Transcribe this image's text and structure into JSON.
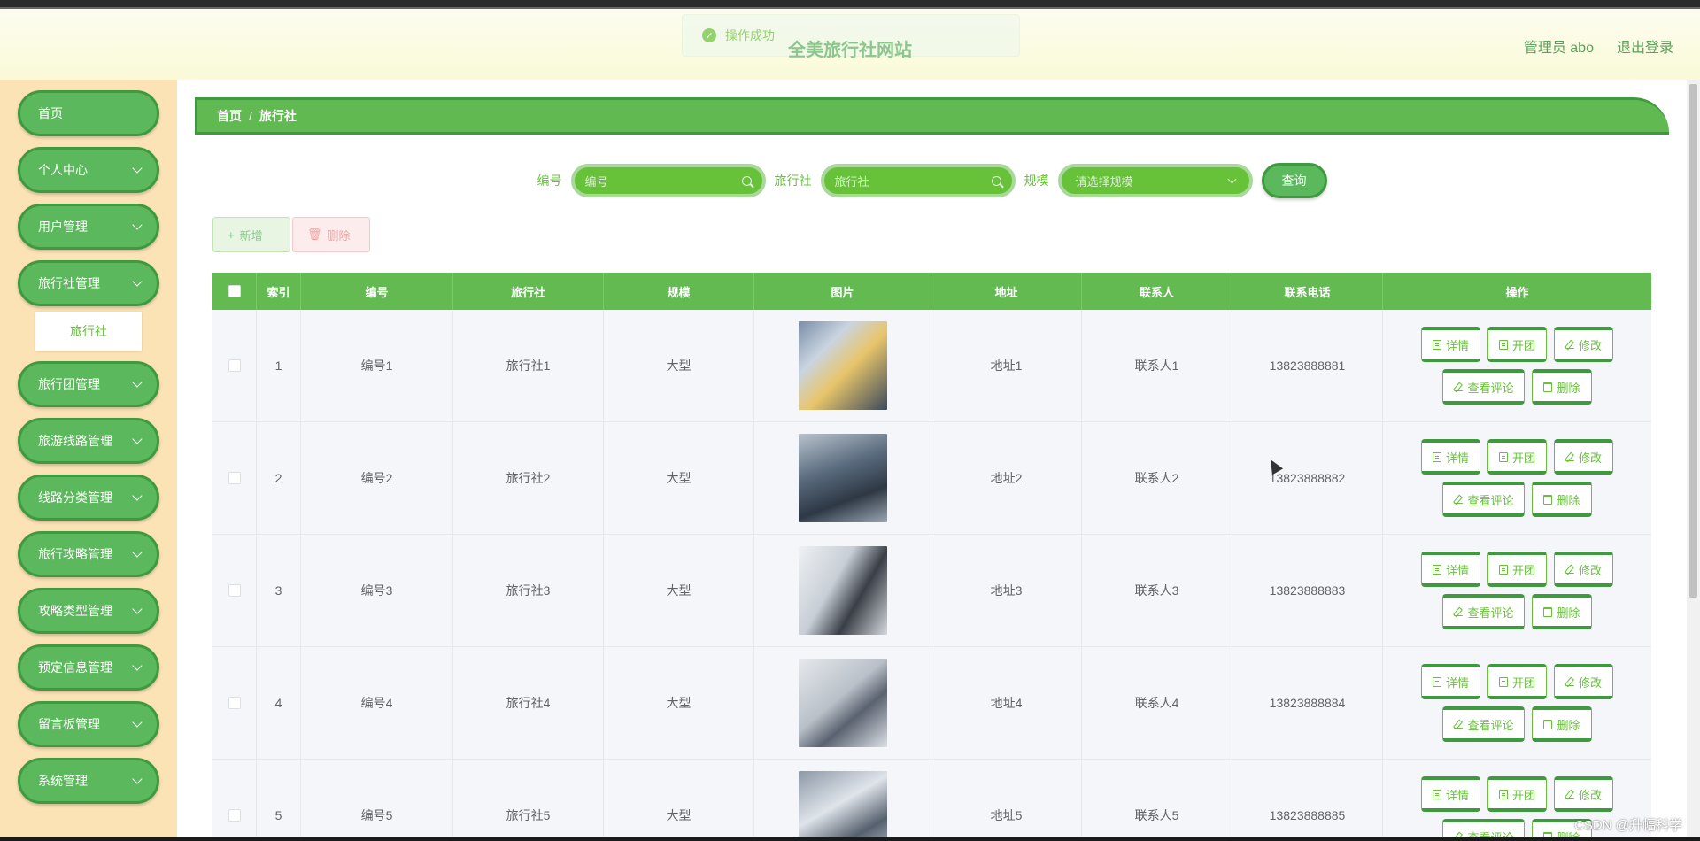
{
  "header": {
    "site_title": "全美旅行社网站",
    "user_label": "管理员 abo",
    "logout_label": "退出登录",
    "toast": "操作成功"
  },
  "sidebar": {
    "items": [
      {
        "label": "首页",
        "has_children": false
      },
      {
        "label": "个人中心",
        "has_children": true
      },
      {
        "label": "用户管理",
        "has_children": true
      },
      {
        "label": "旅行社管理",
        "has_children": true
      },
      {
        "label": "旅行团管理",
        "has_children": true
      },
      {
        "label": "旅游线路管理",
        "has_children": true
      },
      {
        "label": "线路分类管理",
        "has_children": true
      },
      {
        "label": "旅行攻略管理",
        "has_children": true
      },
      {
        "label": "攻略类型管理",
        "has_children": true
      },
      {
        "label": "预定信息管理",
        "has_children": true
      },
      {
        "label": "留言板管理",
        "has_children": true
      },
      {
        "label": "系统管理",
        "has_children": true
      }
    ],
    "sub_item": "旅行社"
  },
  "breadcrumb": {
    "home": "首页",
    "sep": "/",
    "current": "旅行社"
  },
  "search": {
    "field1_label": "编号",
    "field1_placeholder": "编号",
    "field2_label": "旅行社",
    "field2_placeholder": "旅行社",
    "field3_label": "规模",
    "field3_placeholder": "请选择规模",
    "query_button": "查询"
  },
  "actions": {
    "add": "新增",
    "delete": "删除"
  },
  "table": {
    "headers": [
      "索引",
      "编号",
      "旅行社",
      "规模",
      "图片",
      "地址",
      "联系人",
      "联系电话",
      "操作"
    ],
    "rows": [
      {
        "index": "1",
        "code": "编号1",
        "agency": "旅行社1",
        "size": "大型",
        "address": "地址1",
        "contact": "联系人1",
        "phone": "13823888881"
      },
      {
        "index": "2",
        "code": "编号2",
        "agency": "旅行社2",
        "size": "大型",
        "address": "地址2",
        "contact": "联系人2",
        "phone": "13823888882"
      },
      {
        "index": "3",
        "code": "编号3",
        "agency": "旅行社3",
        "size": "大型",
        "address": "地址3",
        "contact": "联系人3",
        "phone": "13823888883"
      },
      {
        "index": "4",
        "code": "编号4",
        "agency": "旅行社4",
        "size": "大型",
        "address": "地址4",
        "contact": "联系人4",
        "phone": "13823888884"
      },
      {
        "index": "5",
        "code": "编号5",
        "agency": "旅行社5",
        "size": "大型",
        "address": "地址5",
        "contact": "联系人5",
        "phone": "13823888885"
      }
    ],
    "op_labels": {
      "detail": "详情",
      "open": "开团",
      "edit": "修改",
      "comments": "查看评论",
      "delete": "删除"
    }
  },
  "watermark": "CSDN @升幅科学",
  "colors": {
    "primary": "#5cb85c",
    "primary_dark": "#3f9a3f",
    "sidebar_bg": "#fbe3b5",
    "header_bg": "#fafad8"
  }
}
